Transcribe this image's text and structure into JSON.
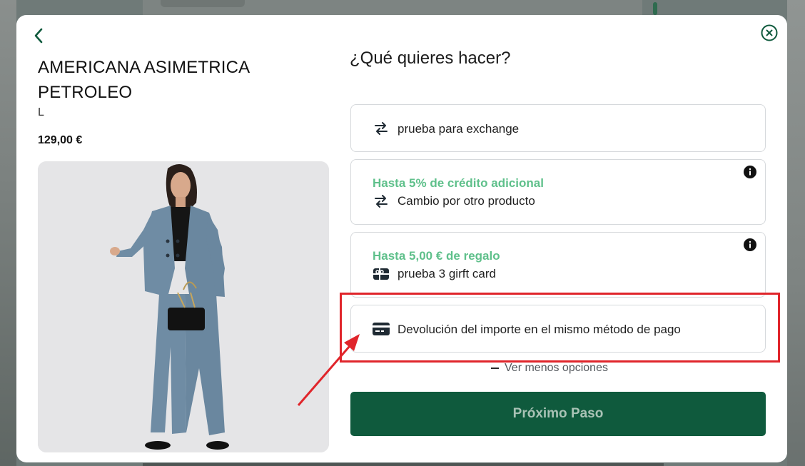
{
  "product": {
    "name": "AMERICANA ASIMETRICA PETROLEO",
    "size": "L",
    "price": "129,00 €"
  },
  "panel": {
    "question": "¿Qué quieres hacer?",
    "options": [
      {
        "label": "prueba para exchange",
        "promo": "",
        "icon": "exchange-arrows-icon"
      },
      {
        "label": "Cambio por otro producto",
        "promo": "Hasta 5% de crédito adicional",
        "icon": "exchange-arrows-icon",
        "info": true
      },
      {
        "label": "prueba 3 girft card",
        "promo": "Hasta 5,00 € de regalo",
        "icon": "gift-card-icon",
        "info": true
      },
      {
        "label": "Devolución del importe en el mismo método de pago",
        "promo": "",
        "icon": "credit-card-icon"
      }
    ],
    "less_options": "Ver menos opciones",
    "next_button": "Próximo Paso"
  },
  "colors": {
    "brand": "#0f5a3d",
    "promo": "#5fc08b",
    "annotation": "#e0252b"
  }
}
